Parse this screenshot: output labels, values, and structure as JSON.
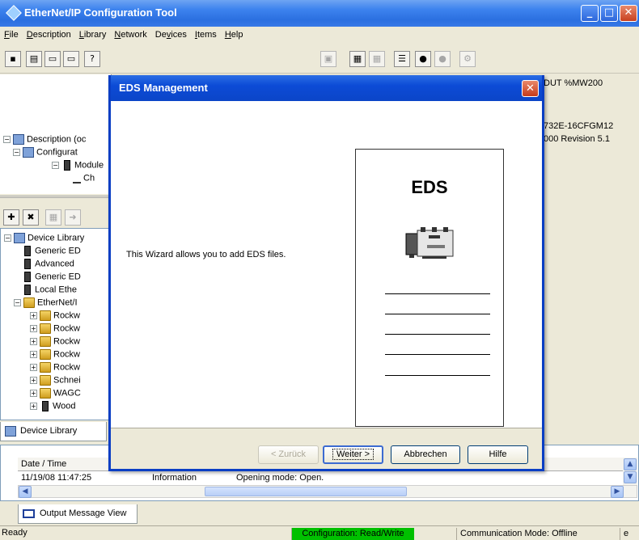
{
  "window": {
    "title": "EtherNet/IP Configuration Tool",
    "controls": {
      "minimize": "_",
      "maximize": "□",
      "close": "✕"
    }
  },
  "menu": [
    {
      "underline": "F",
      "rest": "ile"
    },
    {
      "underline": "D",
      "rest": "escription"
    },
    {
      "underline": "L",
      "rest": "ibrary"
    },
    {
      "underline": "N",
      "rest": "etwork"
    },
    {
      "prefix": "De",
      "underline": "v",
      "rest": "ices"
    },
    {
      "underline": "I",
      "rest": "tems"
    },
    {
      "underline": "H",
      "rest": "elp"
    }
  ],
  "toolbar": {
    "icons": [
      "save-icon",
      "print-icon",
      "window-icon",
      "window-icon",
      "help-icon",
      "delete-icon",
      "properties-icon",
      "properties-icon",
      "list-icon",
      "network-icon",
      "network-icon",
      "config-icon"
    ],
    "help_glyph": "?"
  },
  "description_tree": [
    {
      "label": "Description (oc",
      "level": 0,
      "exp": "−"
    },
    {
      "label": "Configurat",
      "level": 1,
      "exp": "−"
    },
    {
      "label": "Module",
      "level": 2,
      "exp": "−"
    },
    {
      "label": "Ch",
      "level": 3,
      "exp": ""
    }
  ],
  "right_info": {
    "line1": "DUT %MW200",
    "line2": "732E-16CFGM12",
    "line3": "000 Revision 5.1"
  },
  "library_tree": [
    {
      "label": "Device Library",
      "level": 0,
      "exp": "−",
      "icon": "lib"
    },
    {
      "label": "Generic ED",
      "level": 1,
      "exp": "",
      "icon": "dev"
    },
    {
      "label": "Advanced",
      "level": 1,
      "exp": "",
      "icon": "dev"
    },
    {
      "label": "Generic ED",
      "level": 1,
      "exp": "",
      "icon": "dev"
    },
    {
      "label": "Local Ethe",
      "level": 1,
      "exp": "",
      "icon": "dev"
    },
    {
      "label": "EtherNet/I",
      "level": 1,
      "exp": "−",
      "icon": "folder"
    },
    {
      "label": "Rockw",
      "level": 2,
      "exp": "+",
      "icon": "folder"
    },
    {
      "label": "Rockw",
      "level": 2,
      "exp": "+",
      "icon": "folder"
    },
    {
      "label": "Rockw",
      "level": 2,
      "exp": "+",
      "icon": "folder"
    },
    {
      "label": "Rockw",
      "level": 2,
      "exp": "+",
      "icon": "folder"
    },
    {
      "label": "Rockw",
      "level": 2,
      "exp": "+",
      "icon": "folder"
    },
    {
      "label": "Schnei",
      "level": 2,
      "exp": "+",
      "icon": "folder"
    },
    {
      "label": "WAGC",
      "level": 2,
      "exp": "+",
      "icon": "folder"
    },
    {
      "label": "Wood",
      "level": 2,
      "exp": "+",
      "icon": "dev"
    }
  ],
  "library_tab": {
    "label": "Device Library"
  },
  "log": {
    "headers": [
      "Date / Time"
    ],
    "rows": [
      {
        "time": "11/19/08 11:47:25",
        "type": "Information",
        "message": "Opening mode: Open."
      }
    ]
  },
  "output_tab": {
    "label": "Output Message View"
  },
  "status": {
    "ready": "Ready",
    "configuration": "Configuration: Read/Write",
    "mode": "Communication Mode: Offline",
    "extra": "e"
  },
  "dialog": {
    "title": "EDS Management",
    "close": "✕",
    "wizard_text": "This Wizard allows you to add EDS files.",
    "card_label": "EDS",
    "buttons": {
      "back": "< Zurück",
      "next": "Weiter >",
      "cancel": "Abbrechen",
      "help": "Hilfe"
    }
  },
  "colors": {
    "title_bar": "#2b6fe0",
    "dialog_border": "#0a3ec4",
    "close_button": "#c8401f",
    "status_config": "#00c000"
  }
}
